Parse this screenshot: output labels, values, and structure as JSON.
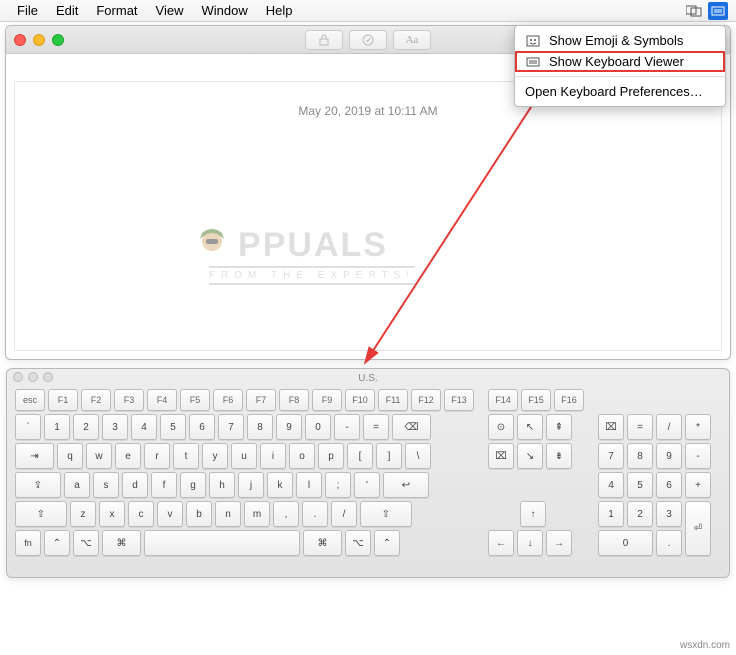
{
  "menubar": {
    "items": [
      "File",
      "Edit",
      "Format",
      "View",
      "Window",
      "Help"
    ]
  },
  "dropdown": {
    "emoji_label": "Show Emoji & Symbols",
    "keyboard_label": "Show Keyboard Viewer",
    "prefs_label": "Open Keyboard Preferences…"
  },
  "doc": {
    "datetime": "May 20, 2019 at 10:11 AM"
  },
  "watermark": {
    "title": "PPUALS",
    "sub": "FROM THE EXPERTS!"
  },
  "keyboard": {
    "title": "U.S.",
    "fn_row": [
      "esc",
      "F1",
      "F2",
      "F3",
      "F4",
      "F5",
      "F6",
      "F7",
      "F8",
      "F9",
      "F10",
      "F11",
      "F12",
      "F13"
    ],
    "fn_right": [
      "F14",
      "F15",
      "F16"
    ],
    "row1": [
      "`",
      "1",
      "2",
      "3",
      "4",
      "5",
      "6",
      "7",
      "8",
      "9",
      "0",
      "-",
      "="
    ],
    "row1_del": "⌫",
    "row2_tab": "⇥",
    "row2": [
      "q",
      "w",
      "e",
      "r",
      "t",
      "y",
      "u",
      "i",
      "o",
      "p",
      "[",
      "]",
      "\\"
    ],
    "row3_caps": "⇪",
    "row3": [
      "a",
      "s",
      "d",
      "f",
      "g",
      "h",
      "j",
      "k",
      "l",
      ";",
      "'"
    ],
    "row3_ret": "↩",
    "row4_shift": "⇧",
    "row4": [
      "z",
      "x",
      "c",
      "v",
      "b",
      "n",
      "m",
      ",",
      ".",
      "/"
    ],
    "row5": {
      "fn": "fn",
      "ctrl": "⌃",
      "opt": "⌥",
      "cmd": "⌘",
      "opt2": "⌥",
      "ctrl2": "⌃"
    },
    "nav1": [
      "⊙",
      "↖",
      "⇞"
    ],
    "nav2": [
      "⌧",
      "↘",
      "⇟"
    ],
    "arrows": {
      "up": "↑",
      "left": "←",
      "down": "↓",
      "right": "→"
    },
    "numpad": {
      "r0": [
        "⌧",
        "=",
        "/",
        "*"
      ],
      "r1": [
        "7",
        "8",
        "9",
        "-"
      ],
      "r2": [
        "4",
        "5",
        "6",
        "+"
      ],
      "r3": [
        "1",
        "2",
        "3"
      ],
      "enter": "⏎",
      "zero": "0",
      "dot": "."
    }
  },
  "credit": "wsxdn.com"
}
